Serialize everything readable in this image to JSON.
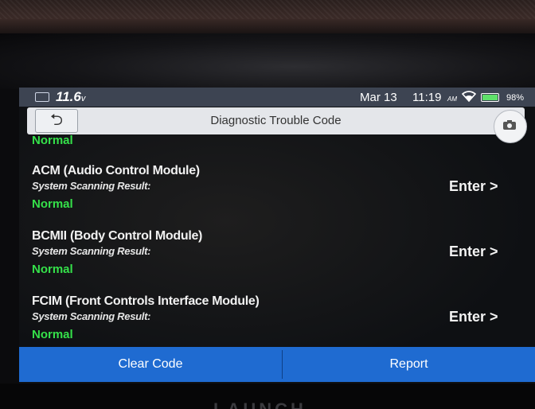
{
  "status_bar": {
    "voltage": "11.6",
    "voltage_unit": "v",
    "date": "Mar 13",
    "time": "11:19",
    "ampm": "AM",
    "battery_percent": "98%",
    "battery_level": 0.98
  },
  "header": {
    "back_glyph": "⮌",
    "title": "Diagnostic Trouble Code"
  },
  "list": {
    "previous_result": "Normal",
    "modules": [
      {
        "name": "ACM (Audio Control Module)",
        "scan_label": "System Scanning Result:",
        "result": "Normal",
        "enter_label": "Enter >"
      },
      {
        "name": "BCMII (Body Control Module)",
        "scan_label": "System Scanning Result:",
        "result": "Normal",
        "enter_label": "Enter >"
      },
      {
        "name": "FCIM (Front Controls Interface Module)",
        "scan_label": "System Scanning Result:",
        "result": "Normal",
        "enter_label": "Enter >"
      }
    ]
  },
  "footer": {
    "clear_code_label": "Clear Code",
    "report_label": "Report"
  },
  "device": {
    "brand_text": "LAUNCH"
  },
  "icons": {
    "battery": "battery-icon",
    "wifi": "wifi-icon",
    "back": "back-arrow-icon",
    "camera": "camera-icon"
  },
  "colors": {
    "status_bar": "#3d4452",
    "header": "#e4e6ea",
    "normal_green": "#35e04a",
    "footer_blue": "#1f6bd1"
  }
}
